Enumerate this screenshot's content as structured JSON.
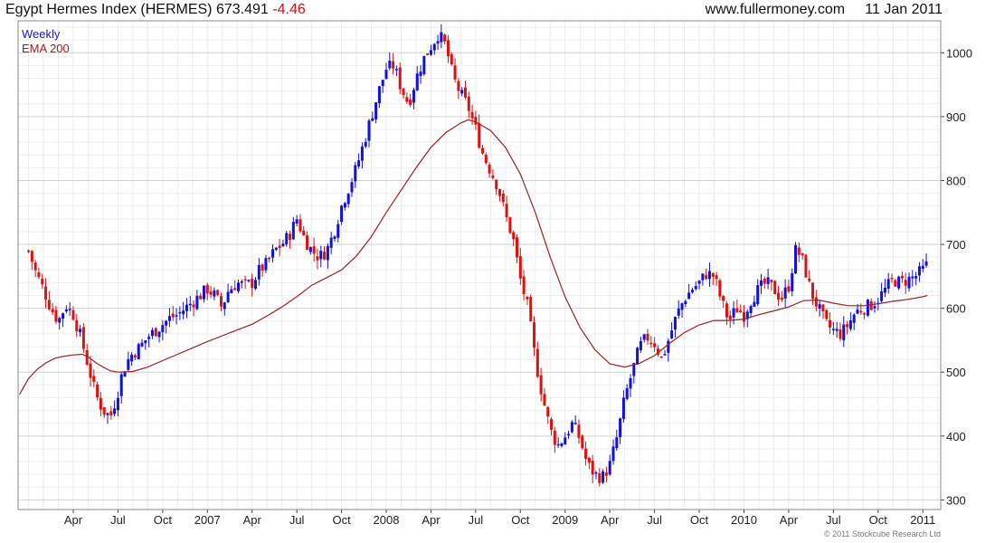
{
  "header": {
    "title": "Egypt Hermes Index (HERMES)",
    "last": "673.491",
    "change": "-4.46",
    "site": "www.fullermoney.com",
    "date": "11 Jan 2011"
  },
  "footer": "© 2011 Stockcube Research Ltd",
  "colors": {
    "up": "#1010e0",
    "down": "#e01010",
    "ema": "#a02020",
    "grid": "#e2e2e2",
    "axis": "#444444"
  },
  "chart_data": {
    "type": "candlestick",
    "interval_label": "Weekly",
    "indicator_label": "EMA 200",
    "y_ticks": [
      300,
      400,
      500,
      600,
      700,
      800,
      900,
      1000
    ],
    "ylim": [
      285,
      1050
    ],
    "x_ticks": [
      "Apr",
      "Jul",
      "Oct",
      "2007",
      "Apr",
      "Jul",
      "Oct",
      "2008",
      "Apr",
      "Jul",
      "Oct",
      "2009",
      "Apr",
      "Jul",
      "Oct",
      "2010",
      "Apr",
      "Jul",
      "Oct",
      "2011"
    ],
    "x_tick_months": [
      3,
      6,
      9,
      12,
      15,
      18,
      21,
      24,
      27,
      30,
      33,
      36,
      39,
      42,
      45,
      48,
      51,
      54,
      57,
      60
    ],
    "xlim_months": [
      -0.7,
      61.2
    ],
    "price_path": [
      [
        0.0,
        690
      ],
      [
        0.5,
        655
      ],
      [
        1.0,
        630
      ],
      [
        1.5,
        600
      ],
      [
        2.0,
        580
      ],
      [
        2.5,
        605
      ],
      [
        3.0,
        590
      ],
      [
        3.5,
        555
      ],
      [
        4.0,
        510
      ],
      [
        4.5,
        465
      ],
      [
        5.0,
        440
      ],
      [
        5.5,
        430
      ],
      [
        6.0,
        470
      ],
      [
        6.3,
        500
      ],
      [
        6.8,
        525
      ],
      [
        7.5,
        540
      ],
      [
        8.0,
        555
      ],
      [
        8.5,
        565
      ],
      [
        9.0,
        575
      ],
      [
        9.5,
        585
      ],
      [
        10.0,
        590
      ],
      [
        10.5,
        600
      ],
      [
        11.0,
        610
      ],
      [
        11.5,
        620
      ],
      [
        12.0,
        630
      ],
      [
        12.5,
        620
      ],
      [
        13.0,
        600
      ],
      [
        13.3,
        625
      ],
      [
        14.0,
        640
      ],
      [
        14.5,
        635
      ],
      [
        15.0,
        640
      ],
      [
        15.5,
        660
      ],
      [
        16.0,
        670
      ],
      [
        16.5,
        690
      ],
      [
        17.0,
        700
      ],
      [
        17.5,
        715
      ],
      [
        18.0,
        740
      ],
      [
        18.5,
        710
      ],
      [
        19.0,
        690
      ],
      [
        19.5,
        680
      ],
      [
        20.0,
        690
      ],
      [
        20.5,
        720
      ],
      [
        21.0,
        760
      ],
      [
        21.5,
        790
      ],
      [
        22.0,
        820
      ],
      [
        22.5,
        860
      ],
      [
        23.0,
        900
      ],
      [
        23.5,
        940
      ],
      [
        24.0,
        975
      ],
      [
        24.5,
        980
      ],
      [
        25.0,
        945
      ],
      [
        25.5,
        920
      ],
      [
        26.0,
        960
      ],
      [
        26.5,
        990
      ],
      [
        27.0,
        1010
      ],
      [
        27.5,
        1030
      ],
      [
        28.0,
        1010
      ],
      [
        28.5,
        960
      ],
      [
        29.0,
        935
      ],
      [
        29.5,
        915
      ],
      [
        30.0,
        880
      ],
      [
        30.5,
        840
      ],
      [
        31.0,
        815
      ],
      [
        31.5,
        790
      ],
      [
        32.0,
        745
      ],
      [
        32.5,
        710
      ],
      [
        33.0,
        645
      ],
      [
        33.5,
        600
      ],
      [
        34.0,
        520
      ],
      [
        34.5,
        460
      ],
      [
        35.0,
        410
      ],
      [
        35.5,
        385
      ],
      [
        36.0,
        400
      ],
      [
        36.5,
        420
      ],
      [
        37.0,
        395
      ],
      [
        37.5,
        355
      ],
      [
        38.0,
        340
      ],
      [
        38.5,
        335
      ],
      [
        39.0,
        355
      ],
      [
        39.5,
        400
      ],
      [
        40.0,
        460
      ],
      [
        40.5,
        500
      ],
      [
        41.0,
        540
      ],
      [
        41.5,
        555
      ],
      [
        42.0,
        545
      ],
      [
        42.5,
        520
      ],
      [
        43.0,
        555
      ],
      [
        43.5,
        590
      ],
      [
        44.0,
        615
      ],
      [
        44.5,
        630
      ],
      [
        45.0,
        640
      ],
      [
        45.5,
        655
      ],
      [
        46.0,
        650
      ],
      [
        46.5,
        610
      ],
      [
        47.0,
        580
      ],
      [
        47.5,
        600
      ],
      [
        48.0,
        590
      ],
      [
        48.5,
        615
      ],
      [
        49.0,
        630
      ],
      [
        49.5,
        640
      ],
      [
        50.0,
        630
      ],
      [
        50.5,
        615
      ],
      [
        51.0,
        635
      ],
      [
        51.5,
        695
      ],
      [
        52.0,
        670
      ],
      [
        52.5,
        625
      ],
      [
        53.0,
        600
      ],
      [
        53.5,
        575
      ],
      [
        54.0,
        565
      ],
      [
        54.5,
        560
      ],
      [
        55.0,
        575
      ],
      [
        55.5,
        595
      ],
      [
        56.0,
        600
      ],
      [
        56.5,
        605
      ],
      [
        57.0,
        615
      ],
      [
        57.5,
        630
      ],
      [
        58.0,
        645
      ],
      [
        58.5,
        640
      ],
      [
        59.0,
        645
      ],
      [
        59.5,
        650
      ],
      [
        60.0,
        660
      ],
      [
        60.3,
        673.491
      ]
    ],
    "ema_path": [
      [
        -0.6,
        465
      ],
      [
        0.0,
        490
      ],
      [
        0.6,
        505
      ],
      [
        1.2,
        515
      ],
      [
        1.8,
        522
      ],
      [
        2.4,
        525
      ],
      [
        3.0,
        527
      ],
      [
        3.6,
        528
      ],
      [
        4.0,
        524
      ],
      [
        4.5,
        515
      ],
      [
        5.0,
        508
      ],
      [
        5.5,
        502
      ],
      [
        6.0,
        500
      ],
      [
        7.0,
        501
      ],
      [
        8.0,
        508
      ],
      [
        9.0,
        518
      ],
      [
        10.0,
        528
      ],
      [
        11.0,
        538
      ],
      [
        12.0,
        548
      ],
      [
        13.0,
        557
      ],
      [
        14.0,
        566
      ],
      [
        15.0,
        575
      ],
      [
        16.0,
        588
      ],
      [
        17.0,
        602
      ],
      [
        18.0,
        618
      ],
      [
        19.0,
        636
      ],
      [
        20.0,
        648
      ],
      [
        21.0,
        660
      ],
      [
        22.0,
        682
      ],
      [
        23.0,
        712
      ],
      [
        24.0,
        750
      ],
      [
        25.0,
        785
      ],
      [
        26.0,
        820
      ],
      [
        27.0,
        852
      ],
      [
        28.0,
        875
      ],
      [
        29.0,
        890
      ],
      [
        29.5,
        895
      ],
      [
        30.0,
        892
      ],
      [
        31.0,
        878
      ],
      [
        32.0,
        852
      ],
      [
        33.0,
        810
      ],
      [
        34.0,
        750
      ],
      [
        35.0,
        680
      ],
      [
        36.0,
        618
      ],
      [
        37.0,
        570
      ],
      [
        38.0,
        535
      ],
      [
        39.0,
        513
      ],
      [
        40.0,
        508
      ],
      [
        41.0,
        514
      ],
      [
        42.0,
        526
      ],
      [
        43.0,
        545
      ],
      [
        44.0,
        562
      ],
      [
        45.0,
        574
      ],
      [
        46.0,
        581
      ],
      [
        47.0,
        581
      ],
      [
        48.0,
        583
      ],
      [
        49.0,
        590
      ],
      [
        50.0,
        596
      ],
      [
        51.0,
        602
      ],
      [
        52.0,
        612
      ],
      [
        53.0,
        613
      ],
      [
        54.0,
        608
      ],
      [
        55.0,
        604
      ],
      [
        56.0,
        604
      ],
      [
        57.0,
        607
      ],
      [
        58.0,
        611
      ],
      [
        59.0,
        614
      ],
      [
        60.0,
        618
      ],
      [
        60.3,
        620
      ]
    ]
  }
}
